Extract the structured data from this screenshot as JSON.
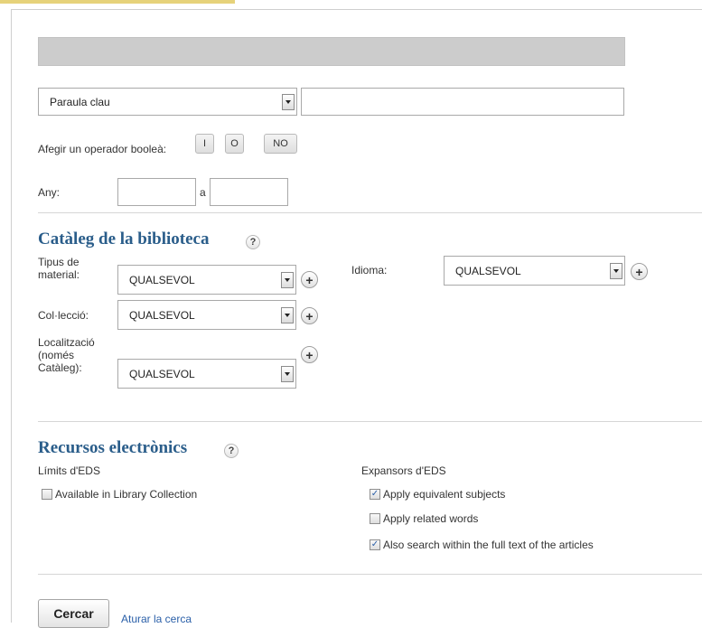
{
  "search": {
    "field_select": "Paraula clau",
    "query_value": "",
    "boolean_label": "Afegir un operador booleà:",
    "operators": [
      "I",
      "O",
      "NO"
    ],
    "year_label": "Any:",
    "year_sep": "a",
    "year_from": "",
    "year_to": ""
  },
  "catalog": {
    "title": "Catàleg de la biblioteca",
    "help": "?",
    "material_label_1": "Tipus de",
    "material_label_2": "material:",
    "material_value": "QUALSEVOL",
    "language_label": "Idioma:",
    "language_value": "QUALSEVOL",
    "collection_label": "Col·lecció:",
    "collection_value": "QUALSEVOL",
    "location_label_1": "Localització",
    "location_label_2": "(només",
    "location_label_3": "Catàleg):",
    "location_value": "QUALSEVOL",
    "plus": "+"
  },
  "electronic": {
    "title": "Recursos electrònics",
    "help": "?",
    "limits_label": "Límits d'EDS",
    "limits": [
      {
        "label": "Available in Library Collection",
        "checked": false
      }
    ],
    "expanders_label": "Expansors d'EDS",
    "expanders": [
      {
        "label": "Apply equivalent subjects",
        "checked": true
      },
      {
        "label": "Apply related words",
        "checked": false
      },
      {
        "label": "Also search within the full text of the articles",
        "checked": true
      }
    ]
  },
  "actions": {
    "search_label": "Cercar",
    "stop_label": "Aturar la cerca"
  },
  "colors": {
    "heading": "#2a5d8a",
    "link": "#2a5fa8",
    "accent_strip": "#e6d27a"
  }
}
